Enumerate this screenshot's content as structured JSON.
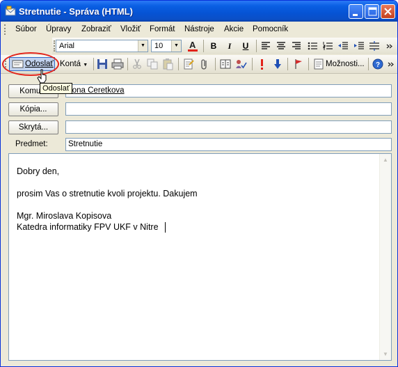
{
  "window": {
    "title": "Stretnutie - Správa (HTML)"
  },
  "menu": [
    {
      "label": "Súbor"
    },
    {
      "label": "Úpravy"
    },
    {
      "label": "Zobraziť"
    },
    {
      "label": "Vložiť"
    },
    {
      "label": "Formát"
    },
    {
      "label": "Nástroje"
    },
    {
      "label": "Akcie"
    },
    {
      "label": "Pomocník"
    }
  ],
  "format": {
    "font_name": "Arial",
    "font_size": "10",
    "bold": "B",
    "italic": "I",
    "underline": "U"
  },
  "toolbar": {
    "send_label": "Odoslať",
    "accounts_label": "Kontá",
    "options_label": "Možnosti..."
  },
  "tooltip": "Odoslať",
  "fields": {
    "to_button": "Komu...",
    "to_value": "Ilona Ceretkova",
    "cc_button": "Kópia...",
    "cc_value": "",
    "bcc_button": "Skrytá...",
    "bcc_value": "",
    "subject_label": "Predmet:",
    "subject_value": "Stretnutie"
  },
  "body": {
    "lines": [
      "Dobry den,",
      "prosim Vas o stretnutie kvoli projektu. Dakujem",
      "Mgr. Miroslava Kopisova",
      "Katedra informatiky FPV UKF v Nitre"
    ]
  },
  "colors": {
    "title_bar": "#0A5FE3",
    "accent_red": "#E2231A",
    "chrome": "#ECE9D8"
  }
}
